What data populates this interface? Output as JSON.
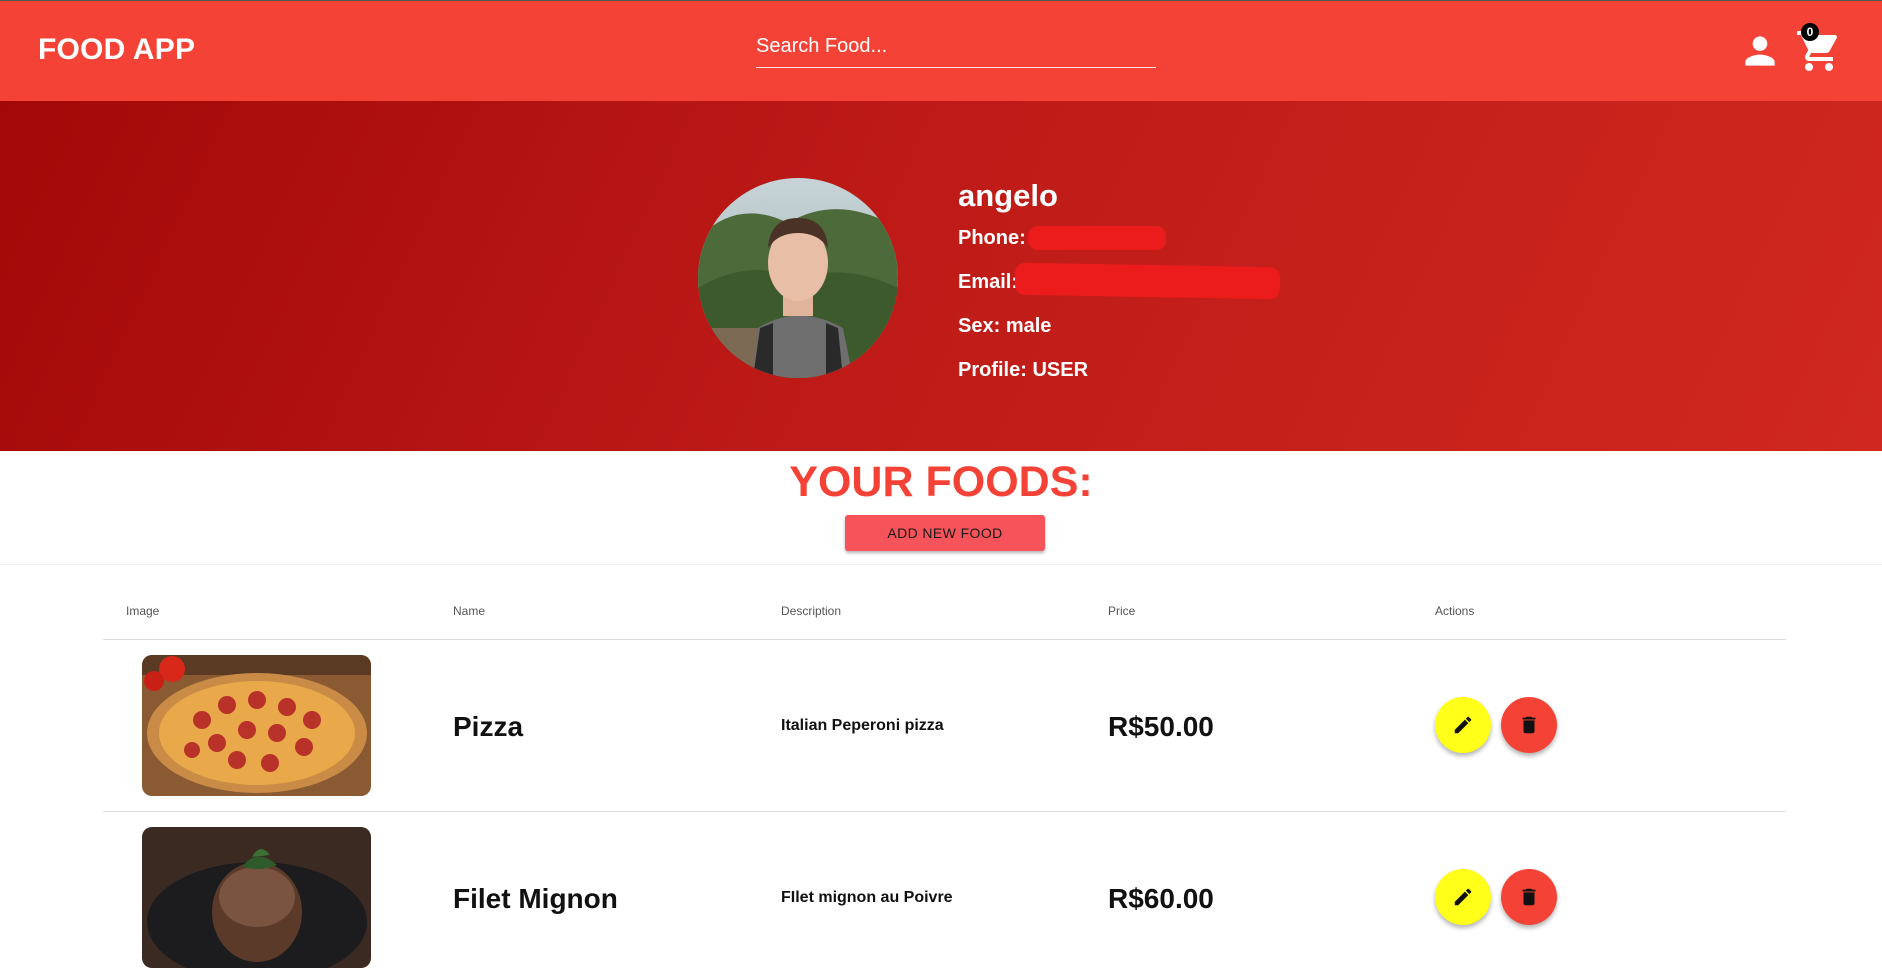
{
  "header": {
    "brand": "FOOD APP",
    "search_placeholder": "Search Food...",
    "cart_count": "0"
  },
  "profile": {
    "name": "angelo",
    "phone_label": "Phone:",
    "email_label": "Email:",
    "sex_label": "Sex:",
    "sex_value": "male",
    "profile_label": "Profile:",
    "profile_value": "USER"
  },
  "section": {
    "title": "YOUR FOODS:",
    "add_button": "ADD NEW FOOD"
  },
  "table": {
    "headers": [
      "Image",
      "Name",
      "Description",
      "Price",
      "Actions"
    ],
    "rows": [
      {
        "name": "Pizza",
        "description": "Italian Peperoni pizza",
        "price": "R$50.00"
      },
      {
        "name": "Filet Mignon",
        "description": "FIlet mignon au Poivre",
        "price": "R$60.00"
      }
    ]
  },
  "icons": {
    "user": "account-icon",
    "cart": "shopping-cart-icon",
    "edit": "pencil-icon",
    "delete": "trash-icon"
  },
  "colors": {
    "primary": "#f44336",
    "hero_dark": "#a30808",
    "edit_button": "#ffff19",
    "add_button": "#f6545a"
  }
}
